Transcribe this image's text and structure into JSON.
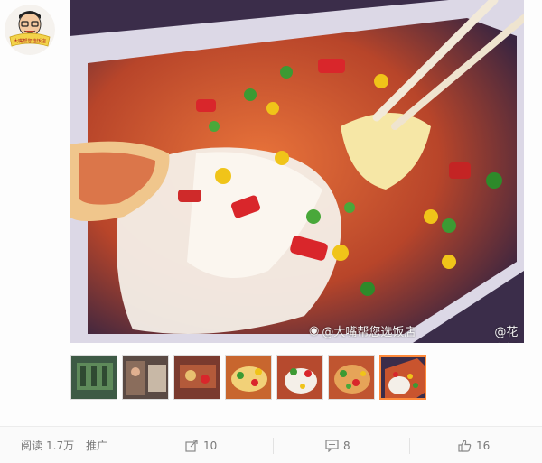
{
  "avatar": {
    "icon": "cartoon-avatar-badge",
    "badge_text": "大嘴帮您选饭店"
  },
  "photo": {
    "watermarks": [
      {
        "icon": "weibo-icon",
        "text": "@大嘴帮您选饭店"
      },
      {
        "icon": "weibo-icon",
        "text": "@花色妖娆erica"
      }
    ]
  },
  "thumbnails": {
    "count": 7,
    "active_index": 6,
    "active_border_color": "#fe8a3c"
  },
  "stats": {
    "read_label": "阅读",
    "read_count": "1.7万",
    "promote_label": "推广",
    "share_count": "10",
    "comment_count": "8",
    "like_count": "16"
  },
  "colors": {
    "text_muted": "#7a7a7a",
    "divider": "#e2e2e2"
  }
}
